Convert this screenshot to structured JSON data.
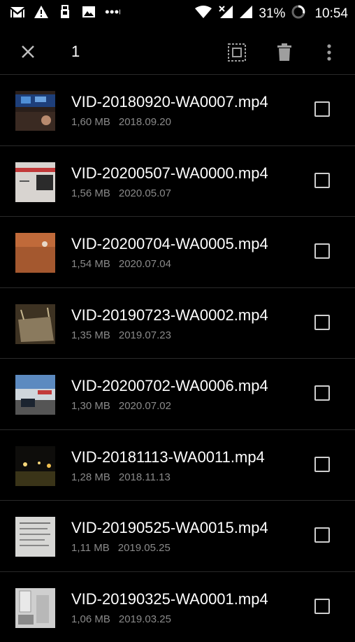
{
  "status_bar": {
    "battery_percent": "31%",
    "time": "10:54",
    "left_icons": [
      "gmail-icon",
      "warning-icon",
      "usb-icon",
      "image-icon",
      "more-dots-icon"
    ],
    "right_icons": [
      "wifi-icon",
      "no-signal-icon",
      "signal-icon",
      "battery-ring-icon"
    ]
  },
  "action_bar": {
    "selected_count": "1",
    "icons": [
      "close-icon",
      "select-all-icon",
      "delete-icon",
      "more-vert-icon"
    ]
  },
  "files": [
    {
      "name": "VID-20180920-WA0007.mp4",
      "size": "1,60 MB",
      "date": "2018.09.20",
      "checked": false
    },
    {
      "name": "VID-20200507-WA0000.mp4",
      "size": "1,56 MB",
      "date": "2020.05.07",
      "checked": false
    },
    {
      "name": "VID-20200704-WA0005.mp4",
      "size": "1,54 MB",
      "date": "2020.07.04",
      "checked": false
    },
    {
      "name": "VID-20190723-WA0002.mp4",
      "size": "1,35 MB",
      "date": "2019.07.23",
      "checked": false
    },
    {
      "name": "VID-20200702-WA0006.mp4",
      "size": "1,30 MB",
      "date": "2020.07.02",
      "checked": false
    },
    {
      "name": "VID-20181113-WA0011.mp4",
      "size": "1,28 MB",
      "date": "2018.11.13",
      "checked": false
    },
    {
      "name": "VID-20190525-WA0015.mp4",
      "size": "1,11 MB",
      "date": "2019.05.25",
      "checked": false
    },
    {
      "name": "VID-20190325-WA0001.mp4",
      "size": "1,06 MB",
      "date": "2019.03.25",
      "checked": false
    }
  ]
}
